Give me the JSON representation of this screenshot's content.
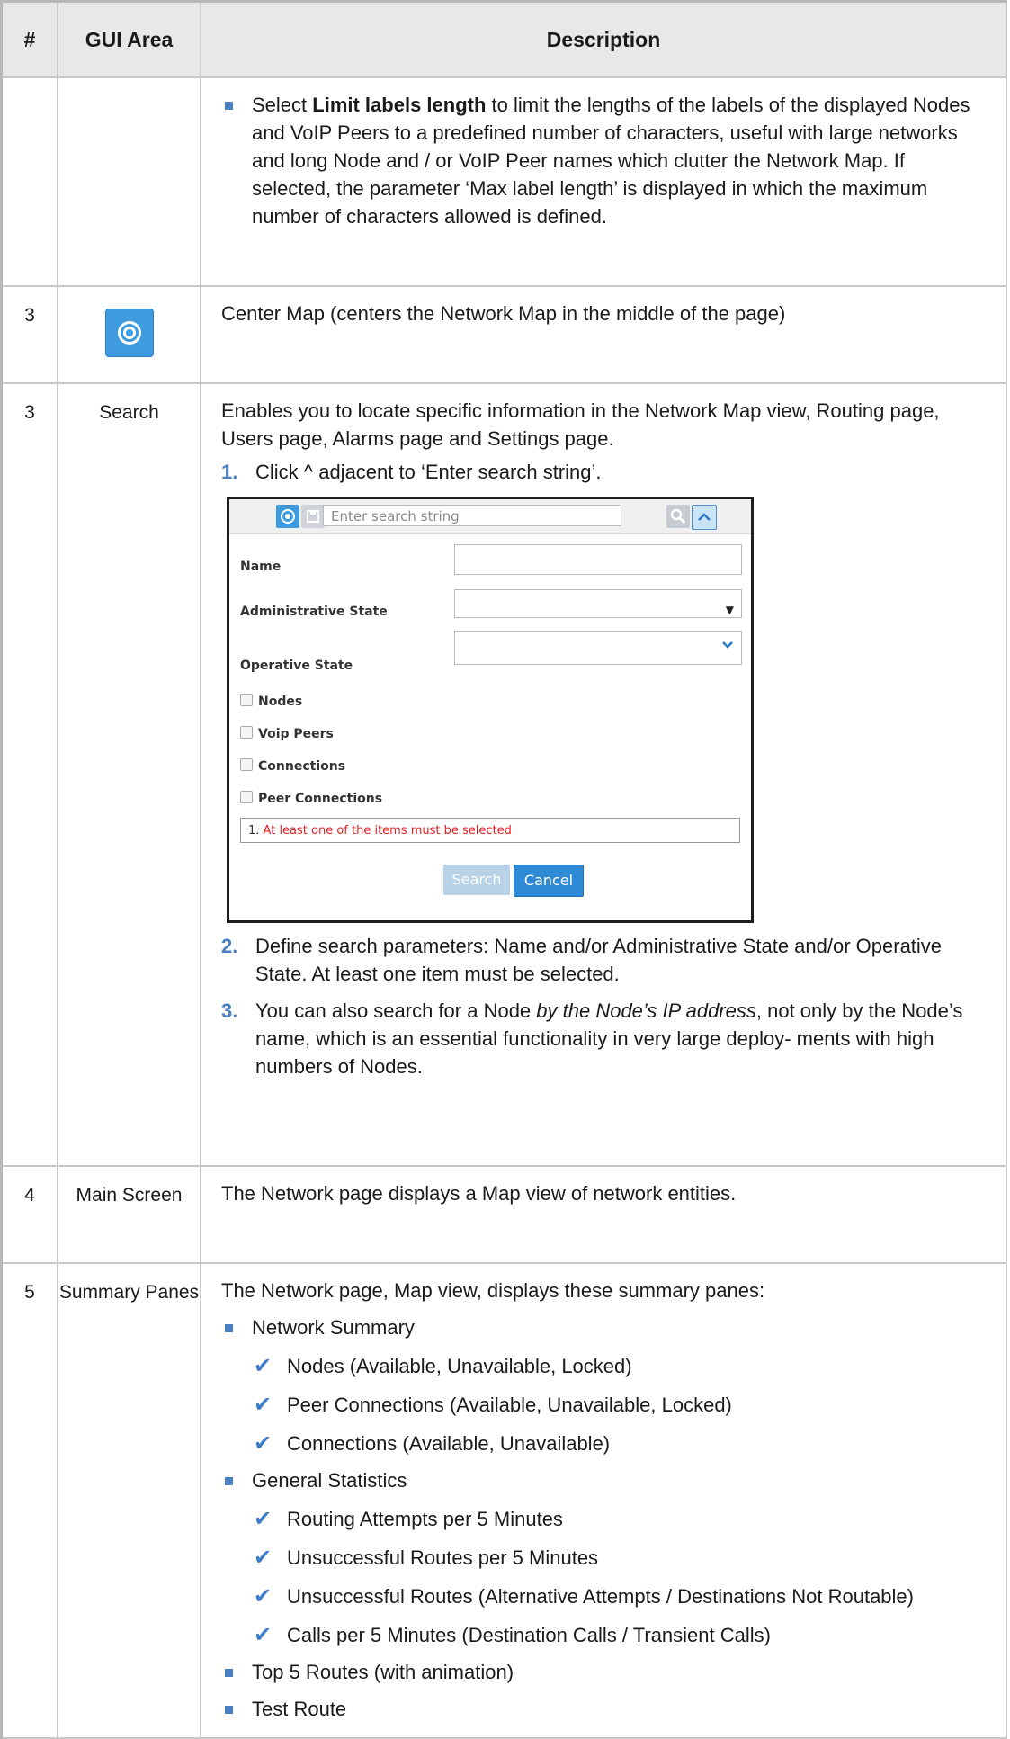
{
  "headers": {
    "num": "#",
    "area": "GUI Area",
    "desc": "Description"
  },
  "row_labels": {
    "limit_bold": "Limit labels length",
    "limit_pre": "Select ",
    "limit_post": " to limit the lengths of the labels of the displayed Nodes and VoIP Peers to a predefined number of characters, useful with large networks and long Node and / or VoIP Peer names which clutter the Network Map. If selected, the parameter ‘Max label length’ is displayed in which the maximum number of characters allowed is defined."
  },
  "center_row": {
    "num": "3",
    "icon": "target-icon",
    "desc": "Center Map (centers the Network Map in the middle of the page)"
  },
  "search_row": {
    "num": "3",
    "area": "Search",
    "intro": "Enables you to locate specific information in the Network Map view, Routing page, Users page, Alarms page and Settings page.",
    "step1_n": "1.",
    "step1": "Click ^ adjacent to ‘Enter search string’.",
    "step2_n": "2.",
    "step2": "Define search parameters: Name and/or Administrative State and/or Operative State. At least one item must be selected.",
    "step3_n": "3.",
    "step3_pre": "You can also search for a Node ",
    "step3_em": "by the Node’s IP address",
    "step3_post": ", not only by the Node’s name, which is an essential functionality in very large deploy- ments with high numbers of Nodes."
  },
  "dialog": {
    "search_placeholder": "Enter search string",
    "name_label": "Name",
    "admin_label": "Administrative State",
    "oper_label": "Operative State",
    "cb1": "Nodes",
    "cb2": "Voip Peers",
    "cb3": "Connections",
    "cb4": "Peer Connections",
    "err_prefix": "1. ",
    "err_text": "At least one of the items must be selected",
    "search_btn": "Search",
    "cancel_btn": "Cancel",
    "accent": "#3e9be0"
  },
  "main_row": {
    "num": "4",
    "area": "Main Screen",
    "desc": "The Network page displays a Map view of network entities."
  },
  "summary_row": {
    "num": "5",
    "area": "Summary Panes",
    "intro": "The Network page, Map view, displays these summary panes:",
    "s1": "Network Summary",
    "s1a": "Nodes (Available, Unavailable, Locked)",
    "s1b": "Peer Connections (Available, Unavailable, Locked)",
    "s1c": "Connections (Available, Unavailable)",
    "s2": "General Statistics",
    "s2a": "Routing Attempts per 5 Minutes",
    "s2b": "Unsuccessful Routes per 5 Minutes",
    "s2c": "Unsuccessful Routes (Alternative Attempts / Destinations Not Routable)",
    "s2d": "Calls per 5 Minutes (Destination Calls / Transient Calls)",
    "s3": "Top 5 Routes (with animation)",
    "s4": "Test Route"
  }
}
